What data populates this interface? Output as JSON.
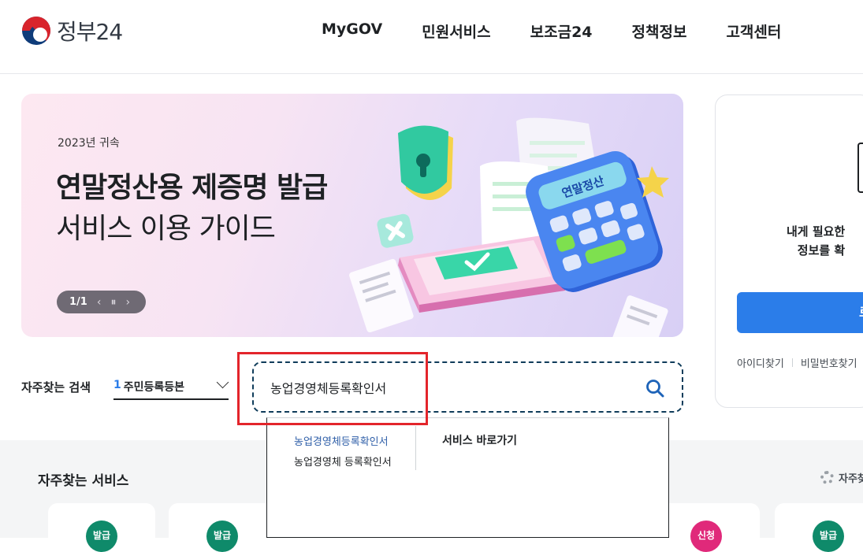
{
  "header": {
    "logo_text": "정부24",
    "nav": [
      "MyGOV",
      "민원서비스",
      "보조금24",
      "정책정보",
      "고객센터"
    ]
  },
  "banner": {
    "small": "2023년 귀속",
    "title": "연말정산용 제증명 발급",
    "subtitle": "서비스 이용 가이드",
    "pager": "1/1",
    "prev_icon": "chevron-left-icon",
    "pause_icon": "pause-icon",
    "next_icon": "chevron-right-icon",
    "calculator_label": "연말정산"
  },
  "login_card": {
    "text_line1": "내게 필요한",
    "text_line2": "정보를 확",
    "button_label": "로",
    "links": [
      "아이디찾기",
      "비밀번호찾기"
    ]
  },
  "search": {
    "label": "자주찾는 검색",
    "frequent_rank": "1",
    "frequent_item": "주민등록등본",
    "input_value": "농업경영체등록확인서"
  },
  "dropdown": {
    "suggestions": [
      "농업경영체등록확인서",
      "농업경영체 등록확인서"
    ],
    "shortcut_title": "서비스 바로가기"
  },
  "frequent_services": {
    "title": "자주찾는 서비스",
    "settings_label": "자주찾",
    "badges": [
      {
        "label": "발급",
        "color": "#0f8a6a"
      },
      {
        "label": "발급",
        "color": "#0f8a6a"
      },
      {
        "label": "신청",
        "color": "#e0297a"
      },
      {
        "label": "발급",
        "color": "#0f8a6a"
      }
    ]
  },
  "colors": {
    "accent": "#2b7de9",
    "highlight_box": "#e3252b",
    "search_border": "#0f3c5a"
  }
}
